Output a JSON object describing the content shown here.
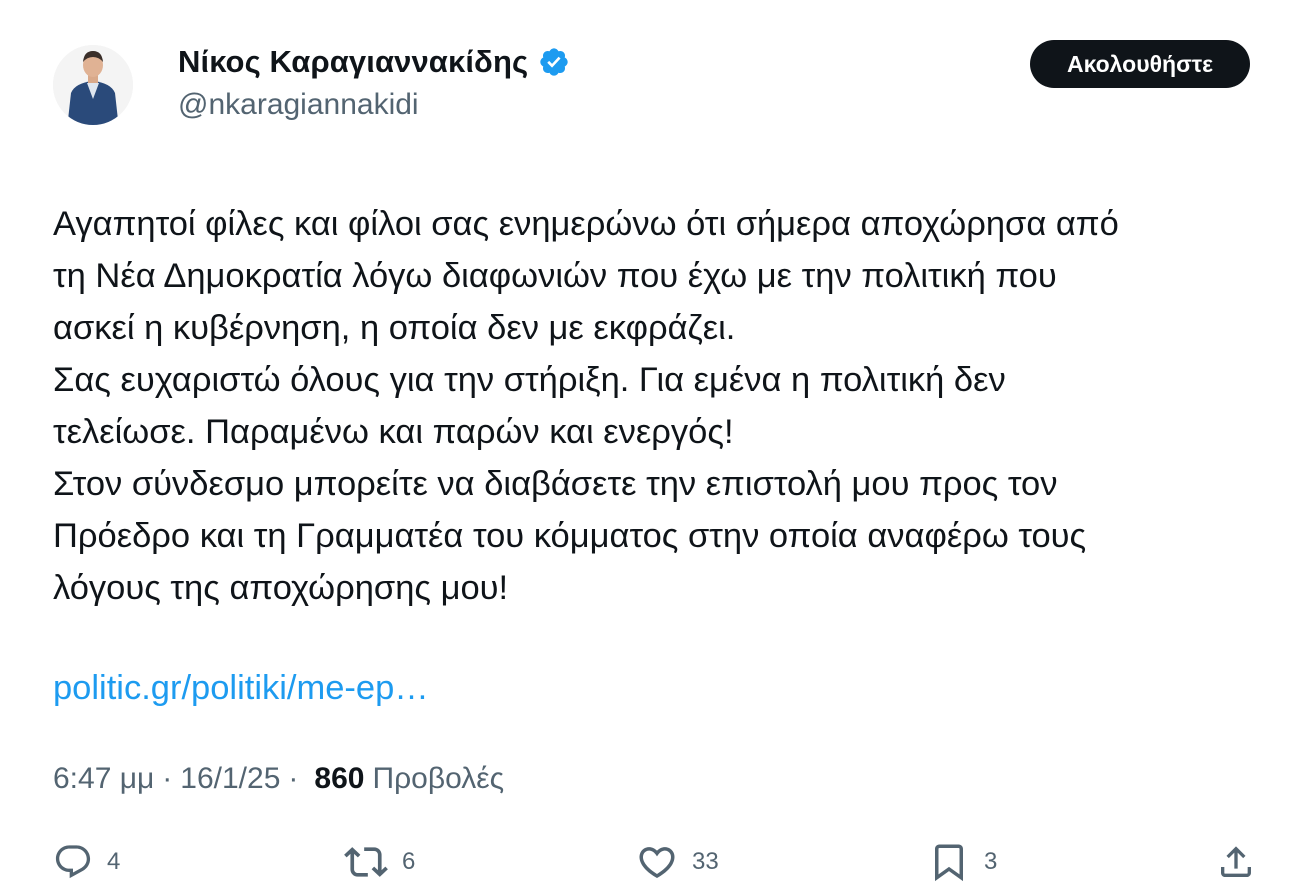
{
  "author": {
    "name": "Νίκος Καραγιαννακίδης",
    "handle": "@nkaragiannakidi",
    "verified": true,
    "verified_color": "#1d9bf0"
  },
  "follow_button": {
    "label": "Ακολουθήστε"
  },
  "tweet": {
    "lines": [
      "Αγαπητοί φίλες και φίλοι σας ενημερώνω ότι σήμερα αποχώρησα από",
      "τη Νέα Δημοκρατία λόγω διαφωνιών που έχω με την πολιτική που",
      "ασκεί η κυβέρνηση, η οποία δεν με εκφράζει.",
      "Σας ευχαριστώ όλους για την στήριξη. Για εμένα η πολιτική δεν",
      "τελείωσε. Παραμένω και παρών και ενεργός!",
      "Στον σύνδεσμο μπορείτε να διαβάσετε την επιστολή μου προς τον",
      "Πρόεδρο και τη Γραμματέα του κόμματος στην οποία αναφέρω τους",
      "λόγους της αποχώρησης μου!"
    ],
    "link_text": "politic.gr/politiki/me-ep…",
    "link_color": "#1d9bf0"
  },
  "meta": {
    "time": "6:47 μμ",
    "date": "16/1/25",
    "views_count": "860",
    "views_label": "Προβολές"
  },
  "actions": {
    "replies": {
      "icon": "reply-icon",
      "count": "4"
    },
    "retweets": {
      "icon": "retweet-icon",
      "count": "6"
    },
    "likes": {
      "icon": "like-icon",
      "count": "33"
    },
    "bookmarks": {
      "icon": "bookmark-icon",
      "count": "3"
    },
    "share": {
      "icon": "share-icon"
    }
  }
}
